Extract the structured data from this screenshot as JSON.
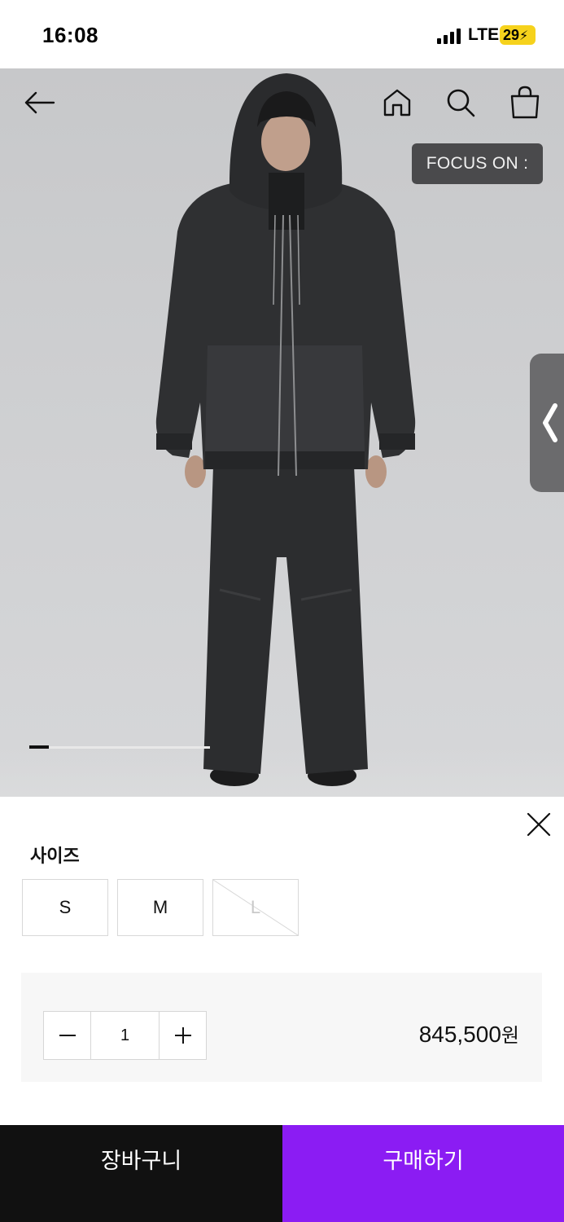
{
  "status_bar": {
    "time": "16:08",
    "network": "LTE",
    "battery": "29",
    "battery_color": "#f6d21c"
  },
  "hero": {
    "focus_label": "FOCUS ON :",
    "progress": 0.11,
    "icons": {
      "back": "arrow-left-icon",
      "home": "home-icon",
      "search": "search-icon",
      "bag": "shopping-bag-icon",
      "side": "chevron-left-icon"
    }
  },
  "sheet": {
    "size_label": "사이즈",
    "sizes": [
      {
        "label": "S",
        "available": true
      },
      {
        "label": "M",
        "available": true
      },
      {
        "label": "L",
        "available": false
      }
    ],
    "quantity": "1",
    "price_value": "845,500",
    "price_unit": "원"
  },
  "actions": {
    "cart_label": "장바구니",
    "buy_label": "구매하기",
    "buy_color": "#8b1cf3"
  }
}
